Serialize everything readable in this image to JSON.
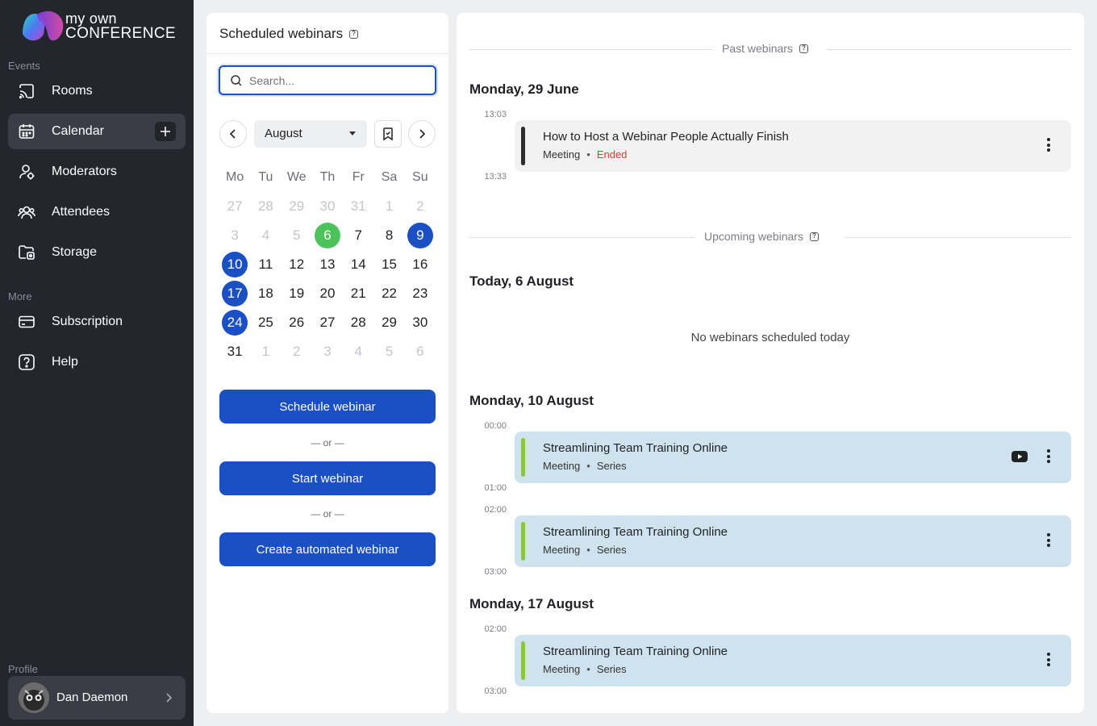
{
  "brand": {
    "line1": "my own",
    "line2": "CONFERENCE"
  },
  "sidebar": {
    "events_label": "Events",
    "more_label": "More",
    "profile_label": "Profile",
    "items": [
      {
        "label": "Rooms",
        "icon": "cast-icon"
      },
      {
        "label": "Calendar",
        "icon": "calendar-icon",
        "active": true
      },
      {
        "label": "Moderators",
        "icon": "moderator-icon"
      },
      {
        "label": "Attendees",
        "icon": "attendees-icon"
      },
      {
        "label": "Storage",
        "icon": "storage-icon"
      }
    ],
    "more_items": [
      {
        "label": "Subscription",
        "icon": "card-icon"
      },
      {
        "label": "Help",
        "icon": "help-icon"
      }
    ],
    "profile_name": "Dan Daemon"
  },
  "scheduler": {
    "title": "Scheduled webinars",
    "search_placeholder": "Search...",
    "month": "August",
    "weekdays": [
      "Mo",
      "Tu",
      "We",
      "Th",
      "Fr",
      "Sa",
      "Su"
    ],
    "weeks": [
      [
        "27",
        "28",
        "29",
        "30",
        "31",
        "1",
        "2"
      ],
      [
        "3",
        "4",
        "5",
        "6",
        "7",
        "8",
        "9"
      ],
      [
        "10",
        "11",
        "12",
        "13",
        "14",
        "15",
        "16"
      ],
      [
        "17",
        "18",
        "19",
        "20",
        "21",
        "22",
        "23"
      ],
      [
        "24",
        "25",
        "26",
        "27",
        "28",
        "29",
        "30"
      ],
      [
        "31",
        "1",
        "2",
        "3",
        "4",
        "5",
        "6"
      ]
    ],
    "schedule_btn": "Schedule webinar",
    "or_text": "— or —",
    "start_btn": "Start webinar",
    "automated_btn": "Create automated webinar"
  },
  "webinars": {
    "past_label": "Past webinars",
    "upcoming_label": "Upcoming webinars",
    "past_day": "Monday, 29 June",
    "past_event": {
      "start": "13:03",
      "end": "13:33",
      "title": "How to Host a Webinar People Actually Finish",
      "type": "Meeting",
      "status": "Ended"
    },
    "today_heading": "Today, 6 August",
    "empty_today": "No webinars scheduled today",
    "day2": "Monday, 10 August",
    "ev1": {
      "start": "00:00",
      "end": "01:00",
      "title": "Streamlining Team Training Online",
      "type": "Meeting",
      "status": "Series"
    },
    "ev2": {
      "start": "02:00",
      "end": "03:00",
      "title": "Streamlining Team Training Online",
      "type": "Meeting",
      "status": "Series"
    },
    "day3": "Monday, 17 August",
    "ev3": {
      "start": "02:00",
      "end": "03:00",
      "title": "Streamlining Team Training Online",
      "type": "Meeting",
      "status": "Series"
    },
    "colors": {
      "past_bar": "#2b2d31",
      "series_bar": "#8cc63f",
      "ended": "#e03a2f",
      "accent": "#1b4fc4",
      "today": "#4cc25a"
    }
  }
}
